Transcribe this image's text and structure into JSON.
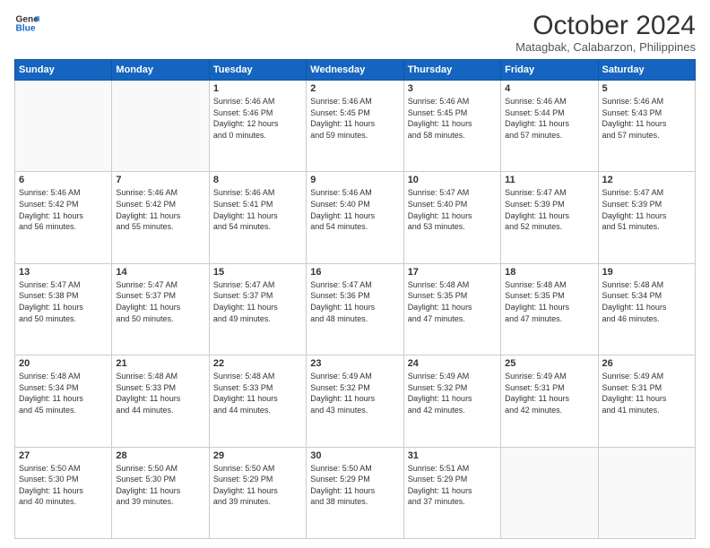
{
  "logo": {
    "line1": "General",
    "line2": "Blue"
  },
  "title": "October 2024",
  "subtitle": "Matagbak, Calabarzon, Philippines",
  "headers": [
    "Sunday",
    "Monday",
    "Tuesday",
    "Wednesday",
    "Thursday",
    "Friday",
    "Saturday"
  ],
  "weeks": [
    [
      {
        "num": "",
        "info": ""
      },
      {
        "num": "",
        "info": ""
      },
      {
        "num": "1",
        "info": "Sunrise: 5:46 AM\nSunset: 5:46 PM\nDaylight: 12 hours\nand 0 minutes."
      },
      {
        "num": "2",
        "info": "Sunrise: 5:46 AM\nSunset: 5:45 PM\nDaylight: 11 hours\nand 59 minutes."
      },
      {
        "num": "3",
        "info": "Sunrise: 5:46 AM\nSunset: 5:45 PM\nDaylight: 11 hours\nand 58 minutes."
      },
      {
        "num": "4",
        "info": "Sunrise: 5:46 AM\nSunset: 5:44 PM\nDaylight: 11 hours\nand 57 minutes."
      },
      {
        "num": "5",
        "info": "Sunrise: 5:46 AM\nSunset: 5:43 PM\nDaylight: 11 hours\nand 57 minutes."
      }
    ],
    [
      {
        "num": "6",
        "info": "Sunrise: 5:46 AM\nSunset: 5:42 PM\nDaylight: 11 hours\nand 56 minutes."
      },
      {
        "num": "7",
        "info": "Sunrise: 5:46 AM\nSunset: 5:42 PM\nDaylight: 11 hours\nand 55 minutes."
      },
      {
        "num": "8",
        "info": "Sunrise: 5:46 AM\nSunset: 5:41 PM\nDaylight: 11 hours\nand 54 minutes."
      },
      {
        "num": "9",
        "info": "Sunrise: 5:46 AM\nSunset: 5:40 PM\nDaylight: 11 hours\nand 54 minutes."
      },
      {
        "num": "10",
        "info": "Sunrise: 5:47 AM\nSunset: 5:40 PM\nDaylight: 11 hours\nand 53 minutes."
      },
      {
        "num": "11",
        "info": "Sunrise: 5:47 AM\nSunset: 5:39 PM\nDaylight: 11 hours\nand 52 minutes."
      },
      {
        "num": "12",
        "info": "Sunrise: 5:47 AM\nSunset: 5:39 PM\nDaylight: 11 hours\nand 51 minutes."
      }
    ],
    [
      {
        "num": "13",
        "info": "Sunrise: 5:47 AM\nSunset: 5:38 PM\nDaylight: 11 hours\nand 50 minutes."
      },
      {
        "num": "14",
        "info": "Sunrise: 5:47 AM\nSunset: 5:37 PM\nDaylight: 11 hours\nand 50 minutes."
      },
      {
        "num": "15",
        "info": "Sunrise: 5:47 AM\nSunset: 5:37 PM\nDaylight: 11 hours\nand 49 minutes."
      },
      {
        "num": "16",
        "info": "Sunrise: 5:47 AM\nSunset: 5:36 PM\nDaylight: 11 hours\nand 48 minutes."
      },
      {
        "num": "17",
        "info": "Sunrise: 5:48 AM\nSunset: 5:35 PM\nDaylight: 11 hours\nand 47 minutes."
      },
      {
        "num": "18",
        "info": "Sunrise: 5:48 AM\nSunset: 5:35 PM\nDaylight: 11 hours\nand 47 minutes."
      },
      {
        "num": "19",
        "info": "Sunrise: 5:48 AM\nSunset: 5:34 PM\nDaylight: 11 hours\nand 46 minutes."
      }
    ],
    [
      {
        "num": "20",
        "info": "Sunrise: 5:48 AM\nSunset: 5:34 PM\nDaylight: 11 hours\nand 45 minutes."
      },
      {
        "num": "21",
        "info": "Sunrise: 5:48 AM\nSunset: 5:33 PM\nDaylight: 11 hours\nand 44 minutes."
      },
      {
        "num": "22",
        "info": "Sunrise: 5:48 AM\nSunset: 5:33 PM\nDaylight: 11 hours\nand 44 minutes."
      },
      {
        "num": "23",
        "info": "Sunrise: 5:49 AM\nSunset: 5:32 PM\nDaylight: 11 hours\nand 43 minutes."
      },
      {
        "num": "24",
        "info": "Sunrise: 5:49 AM\nSunset: 5:32 PM\nDaylight: 11 hours\nand 42 minutes."
      },
      {
        "num": "25",
        "info": "Sunrise: 5:49 AM\nSunset: 5:31 PM\nDaylight: 11 hours\nand 42 minutes."
      },
      {
        "num": "26",
        "info": "Sunrise: 5:49 AM\nSunset: 5:31 PM\nDaylight: 11 hours\nand 41 minutes."
      }
    ],
    [
      {
        "num": "27",
        "info": "Sunrise: 5:50 AM\nSunset: 5:30 PM\nDaylight: 11 hours\nand 40 minutes."
      },
      {
        "num": "28",
        "info": "Sunrise: 5:50 AM\nSunset: 5:30 PM\nDaylight: 11 hours\nand 39 minutes."
      },
      {
        "num": "29",
        "info": "Sunrise: 5:50 AM\nSunset: 5:29 PM\nDaylight: 11 hours\nand 39 minutes."
      },
      {
        "num": "30",
        "info": "Sunrise: 5:50 AM\nSunset: 5:29 PM\nDaylight: 11 hours\nand 38 minutes."
      },
      {
        "num": "31",
        "info": "Sunrise: 5:51 AM\nSunset: 5:29 PM\nDaylight: 11 hours\nand 37 minutes."
      },
      {
        "num": "",
        "info": ""
      },
      {
        "num": "",
        "info": ""
      }
    ]
  ]
}
